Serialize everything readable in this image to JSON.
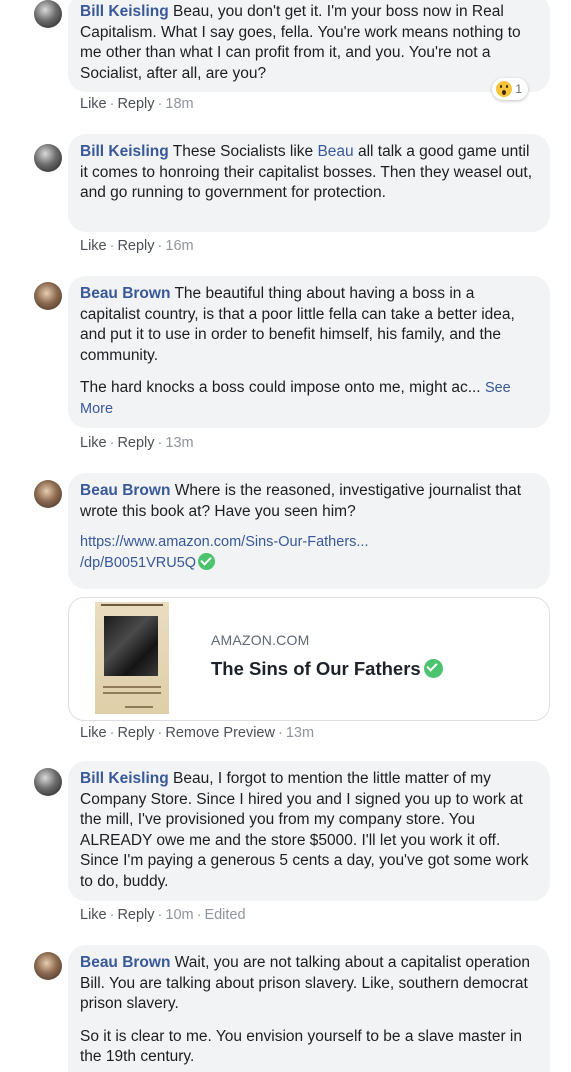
{
  "comments": [
    {
      "author": "Bill Keisling",
      "text": " Beau, you don't get it. I'm your boss now in Real Capitalism. What I say goes, fella. You're work means nothing to me other than what I can profit from it, and you. You're not a Socialist, after all, are you?",
      "reaction_count": "1",
      "reaction_icon": "wow-emoji-icon",
      "like": "Like",
      "reply": "Reply",
      "time": "18m"
    },
    {
      "author": "Bill Keisling",
      "text_before": " These Socialists like ",
      "mention": "Beau",
      "text_after": " all talk a good game until it comes to honroing their capitalist bosses. Then they weasel out, and go running to government for protection.",
      "like": "Like",
      "reply": "Reply",
      "time": "16m"
    },
    {
      "author": "Beau Brown",
      "text": " The beautiful thing about having a boss in a capitalist country, is that a poor little fella can take a better idea, and put it to use in order to benefit himself, his family, and the community.",
      "text2": "The hard knocks a boss could impose onto me, might ac...",
      "see_more": "See More",
      "like": "Like",
      "reply": "Reply",
      "time": "13m"
    },
    {
      "author": "Beau Brown",
      "text": " Where is the reasoned, investigative journalist that wrote this book at? Have you seen him?",
      "url_line1": "https://www.amazon.com/Sins-Our-Fathers...",
      "url_line2": "/dp/B0051VRU5Q",
      "like": "Like",
      "reply": "Reply",
      "remove_preview": "Remove Preview",
      "time": "13m"
    },
    {
      "author": "Bill Keisling",
      "text": " Beau, I forgot to mention the little matter of my Company Store. Since I hired you and I signed you up to work at the mill, I've provisioned you from my company store. You ALREADY owe me and the store $5000. I'll let you work it off. Since I'm paying a generous 5 cents a day, you've got some work to do, buddy.",
      "like": "Like",
      "reply": "Reply",
      "time": "10m",
      "edited": "Edited"
    },
    {
      "author": "Beau Brown",
      "text": " Wait, you are not talking about a capitalist operation Bill. You are talking about prison slavery. Like, southern democrat prison slavery.",
      "text2": "So it is clear to me. You envision yourself to be a slave master in the 19th century."
    }
  ],
  "link_preview": {
    "source": "AMAZON.COM",
    "title": "The Sins of Our Fathers"
  },
  "colors": {
    "name_link": "#385898",
    "bubble_bg": "#f2f3f5",
    "verified": "#4cc36e"
  }
}
